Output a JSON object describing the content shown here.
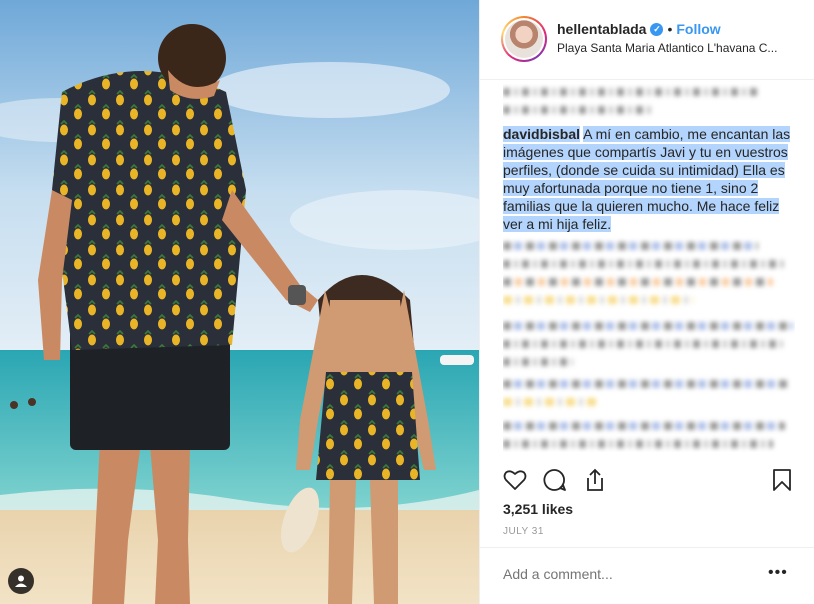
{
  "header": {
    "username": "hellentablada",
    "verified_badge": "✓",
    "separator": "•",
    "follow_label": "Follow",
    "location": "Playa Santa Maria Atlantico L'havana C..."
  },
  "caption": {
    "username": "davidbisbal",
    "text": "A mí en cambio, me encantan las imágenes que compartís Javi y tu en vuestros perfiles, (donde se cuida su intimidad) Ella es muy afortunada porque no tiene 1, sino 2 familias que la quieren mucho. Me hace feliz ver a mi hija feliz."
  },
  "actions": {
    "like_icon": "heart-icon",
    "comment_icon": "comment-icon",
    "share_icon": "share-icon",
    "save_icon": "bookmark-icon"
  },
  "likes": "3,251 likes",
  "date": "JULY 31",
  "comment_input": {
    "placeholder": "Add a comment..."
  },
  "more_label": "•••",
  "colors": {
    "accent": "#3897f0",
    "highlight": "#b3d4fc",
    "muted": "#999999"
  }
}
